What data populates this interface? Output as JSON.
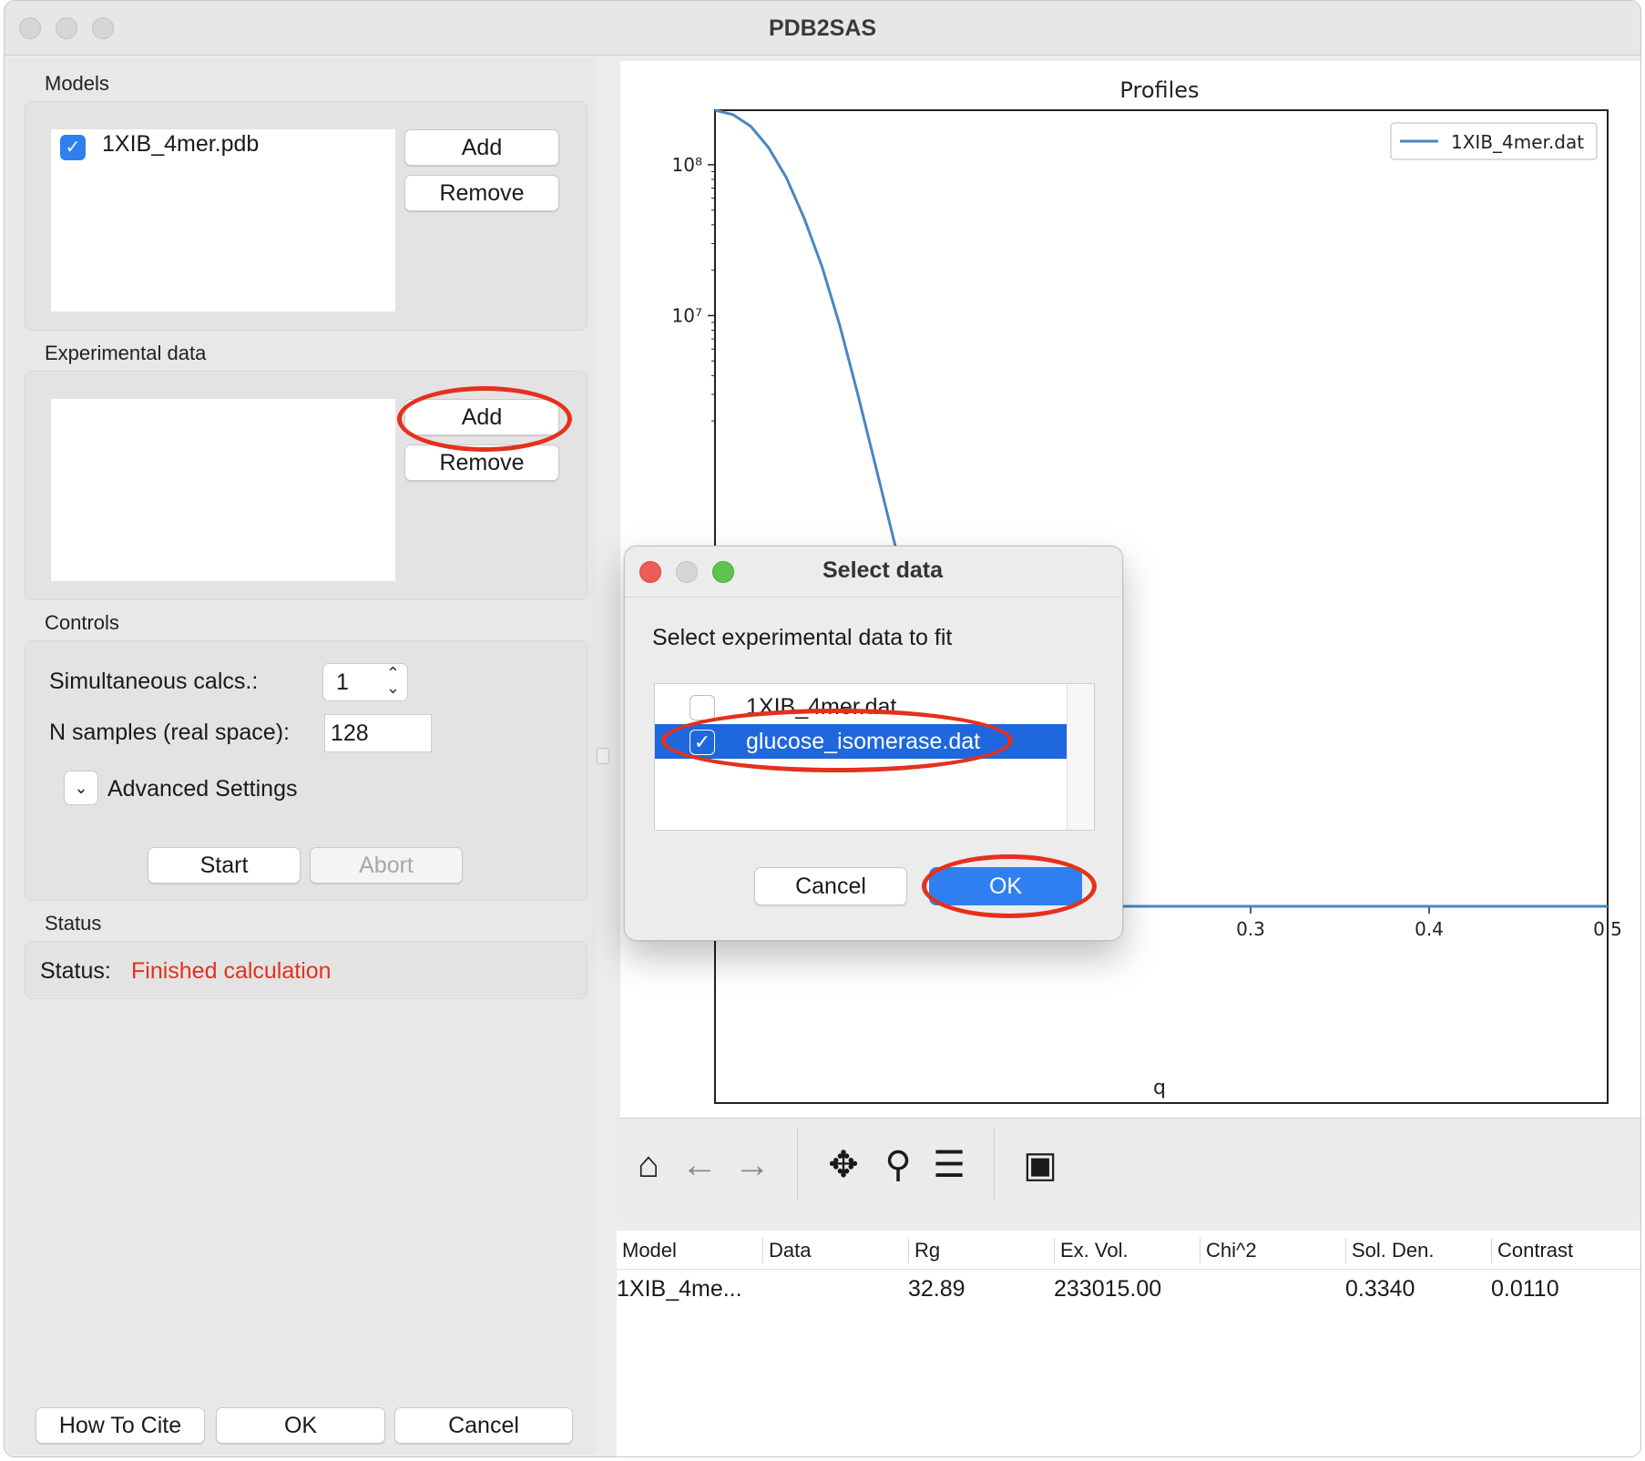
{
  "window": {
    "title": "PDB2SAS"
  },
  "models": {
    "label": "Models",
    "items": [
      {
        "name": "1XIB_4mer.pdb",
        "checked": true
      }
    ],
    "add_label": "Add",
    "remove_label": "Remove"
  },
  "experimental": {
    "label": "Experimental data",
    "add_label": "Add",
    "remove_label": "Remove"
  },
  "controls": {
    "label": "Controls",
    "simultaneous_label": "Simultaneous calcs.:",
    "simultaneous_value": "1",
    "nsamples_label": "N samples (real space):",
    "nsamples_value": "128",
    "advanced_label": "Advanced Settings",
    "start_label": "Start",
    "abort_label": "Abort"
  },
  "status": {
    "label": "Status",
    "prefix": "Status:",
    "text": "Finished calculation",
    "color": "#e5301c"
  },
  "footer": {
    "cite_label": "How To Cite",
    "ok_label": "OK",
    "cancel_label": "Cancel"
  },
  "chart_data": {
    "type": "line",
    "title": "Profiles",
    "xlabel": "q",
    "ylabel": "",
    "yscale": "log",
    "xlim": [
      0.0,
      0.5
    ],
    "xticks": [
      "0.0",
      "0.1",
      "0.2",
      "0.3",
      "0.4",
      "0.5"
    ],
    "yticks_visible": [
      "10⁸",
      "10⁷"
    ],
    "legend": {
      "placement": "top-right"
    },
    "series": [
      {
        "name": "1XIB_4mer.dat",
        "color": "#4a86c2",
        "x": [
          0.0,
          0.01,
          0.02,
          0.03,
          0.04,
          0.05,
          0.06,
          0.07,
          0.08,
          0.09,
          0.1,
          0.11,
          0.12,
          0.13,
          0.14,
          0.15,
          0.16,
          0.17,
          0.18,
          0.19,
          0.2,
          0.21,
          0.22,
          0.23,
          0.24,
          0.25,
          0.26,
          0.27,
          0.28,
          0.29,
          0.3,
          0.31,
          0.32,
          0.33,
          0.34,
          0.35,
          0.36,
          0.37,
          0.38,
          0.39,
          0.4,
          0.41,
          0.42,
          0.43,
          0.44,
          0.45,
          0.46,
          0.47,
          0.48,
          0.49,
          0.5
        ],
        "y": [
          230000000,
          215000000,
          180000000,
          130000000,
          82000000,
          44000000,
          21000000,
          8500000,
          3000000,
          1000000,
          330000,
          110000,
          40000,
          16000,
          7000,
          3400,
          1800,
          1050,
          640,
          390,
          200,
          220,
          340,
          470,
          410,
          240,
          135,
          90,
          70,
          100,
          170,
          250,
          320,
          345,
          320,
          270,
          225,
          205,
          215,
          245,
          290,
          320,
          330,
          310,
          260,
          210,
          170,
          140,
          120,
          125,
          135
        ]
      }
    ]
  },
  "toolbar": {
    "icons": [
      "home-icon",
      "back-arrow-icon",
      "forward-arrow-icon",
      "pan-icon",
      "zoom-icon",
      "configure-icon",
      "save-icon"
    ]
  },
  "results_table": {
    "columns": [
      "Model",
      "Data",
      "Rg",
      "Ex. Vol.",
      "Chi^2",
      "Sol. Den.",
      "Contrast"
    ],
    "rows": [
      [
        "1XIB_4me...",
        "",
        "32.89",
        "233015.00",
        "",
        "0.3340",
        "0.0110"
      ]
    ]
  },
  "dialog": {
    "title": "Select data",
    "prompt": "Select experimental data to fit",
    "items": [
      {
        "name": "1XIB_4mer.dat",
        "checked": false,
        "selected": false
      },
      {
        "name": "glucose_isomerase.dat",
        "checked": true,
        "selected": true
      }
    ],
    "cancel_label": "Cancel",
    "ok_label": "OK"
  },
  "annotation_color": "#e5301c"
}
